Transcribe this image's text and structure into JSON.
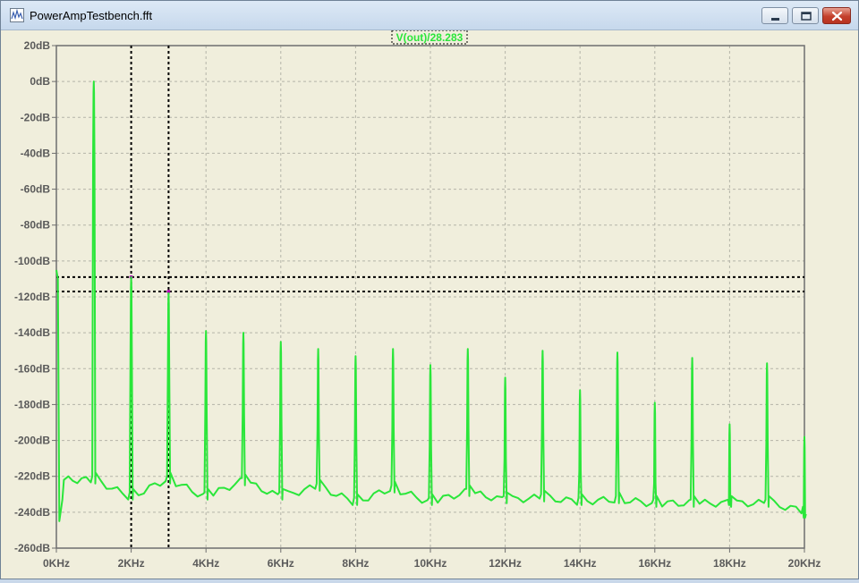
{
  "window": {
    "title": "PowerAmpTestbench.fft"
  },
  "icons": {
    "app": "waveform-icon",
    "minimize": "minimize-icon",
    "maximize": "maximize-icon",
    "close": "close-icon"
  },
  "colors": {
    "trace": "#2ae63a",
    "cursor": "#000000",
    "plot_bg": "#f0eedc",
    "grid": "#b4b4a8"
  },
  "chart_data": {
    "type": "line",
    "title": "",
    "xlabel": "",
    "ylabel": "",
    "xlim": [
      0,
      20
    ],
    "ylim": [
      -260,
      20
    ],
    "x_unit": "KHz",
    "y_unit": "dB",
    "grid": true,
    "x_ticks": [
      "0KHz",
      "2KHz",
      "4KHz",
      "6KHz",
      "8KHz",
      "10KHz",
      "12KHz",
      "14KHz",
      "16KHz",
      "18KHz",
      "20KHz"
    ],
    "y_ticks": [
      "20dB",
      "0dB",
      "-20dB",
      "-40dB",
      "-60dB",
      "-80dB",
      "-100dB",
      "-120dB",
      "-140dB",
      "-160dB",
      "-180dB",
      "-200dB",
      "-220dB",
      "-240dB",
      "-260dB"
    ],
    "series": [
      {
        "name": "V(out)/28.283",
        "color": "#2ae63a",
        "harmonics": [
          {
            "f": 1,
            "peak": 0,
            "floor": -222
          },
          {
            "f": 2,
            "peak": -109,
            "floor": -231
          },
          {
            "f": 3,
            "peak": -118,
            "floor": -222
          },
          {
            "f": 4,
            "peak": -139,
            "floor": -231
          },
          {
            "f": 5,
            "peak": -140,
            "floor": -223
          },
          {
            "f": 6,
            "peak": -145,
            "floor": -231
          },
          {
            "f": 7,
            "peak": -149,
            "floor": -226
          },
          {
            "f": 8,
            "peak": -153,
            "floor": -234
          },
          {
            "f": 9,
            "peak": -149,
            "floor": -227
          },
          {
            "f": 10,
            "peak": -158,
            "floor": -234
          },
          {
            "f": 11,
            "peak": -149,
            "floor": -229
          },
          {
            "f": 12,
            "peak": -165,
            "floor": -233
          },
          {
            "f": 13,
            "peak": -150,
            "floor": -232
          },
          {
            "f": 14,
            "peak": -172,
            "floor": -234
          },
          {
            "f": 15,
            "peak": -151,
            "floor": -233
          },
          {
            "f": 16,
            "peak": -179,
            "floor": -235
          },
          {
            "f": 17,
            "peak": -154,
            "floor": -235
          },
          {
            "f": 18,
            "peak": -191,
            "floor": -235
          },
          {
            "f": 19,
            "peak": -157,
            "floor": -235
          },
          {
            "f": 20,
            "peak": -198,
            "floor": -239
          }
        ],
        "dc": {
          "start": -105,
          "min": -245
        }
      }
    ],
    "cursors": [
      {
        "x": 2,
        "y": -109
      },
      {
        "x": 3,
        "y": -117
      }
    ]
  }
}
